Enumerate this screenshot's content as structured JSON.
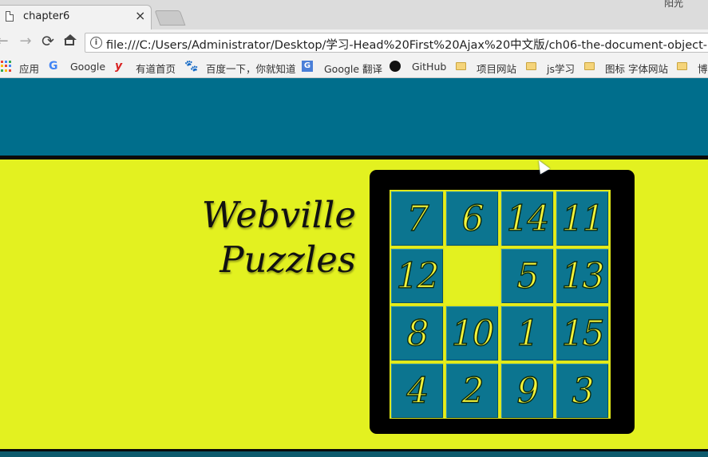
{
  "browser": {
    "tab_title": "chapter6",
    "tab_close": "×",
    "user_name": "阳光",
    "url": "file:///C:/Users/Administrator/Desktop/学习-Head%20First%20Ajax%20中文版/ch06-the-document-object-mo...",
    "nav": {
      "back": "←",
      "forward": "→",
      "reload": "⟳"
    },
    "bookmarks": [
      {
        "label": "应用",
        "icon": "apps-grid-icon"
      },
      {
        "label": "Google",
        "icon": "google-icon"
      },
      {
        "label": "有道首页",
        "icon": "youdao-icon"
      },
      {
        "label": "百度一下，你就知道",
        "icon": "baidu-paw-icon"
      },
      {
        "label": "Google 翻译",
        "icon": "google-translate-icon"
      },
      {
        "label": "GitHub",
        "icon": "github-icon"
      },
      {
        "label": "项目网站",
        "icon": "folder-icon"
      },
      {
        "label": "js学习",
        "icon": "folder-icon"
      },
      {
        "label": "图标 字体网站",
        "icon": "folder-icon"
      },
      {
        "label": "博",
        "icon": "folder-icon"
      }
    ]
  },
  "page": {
    "heading_line1": "Webville",
    "heading_line2": "Puzzles",
    "tiles": [
      "7",
      "6",
      "14",
      "11",
      "12",
      "",
      "5",
      "13",
      "8",
      "10",
      "1",
      "15",
      "4",
      "2",
      "9",
      "3"
    ],
    "colors": {
      "header": "#006e8c",
      "background": "#e3f120",
      "tile": "#0c7590",
      "tile_text": "#f2f43a"
    }
  }
}
